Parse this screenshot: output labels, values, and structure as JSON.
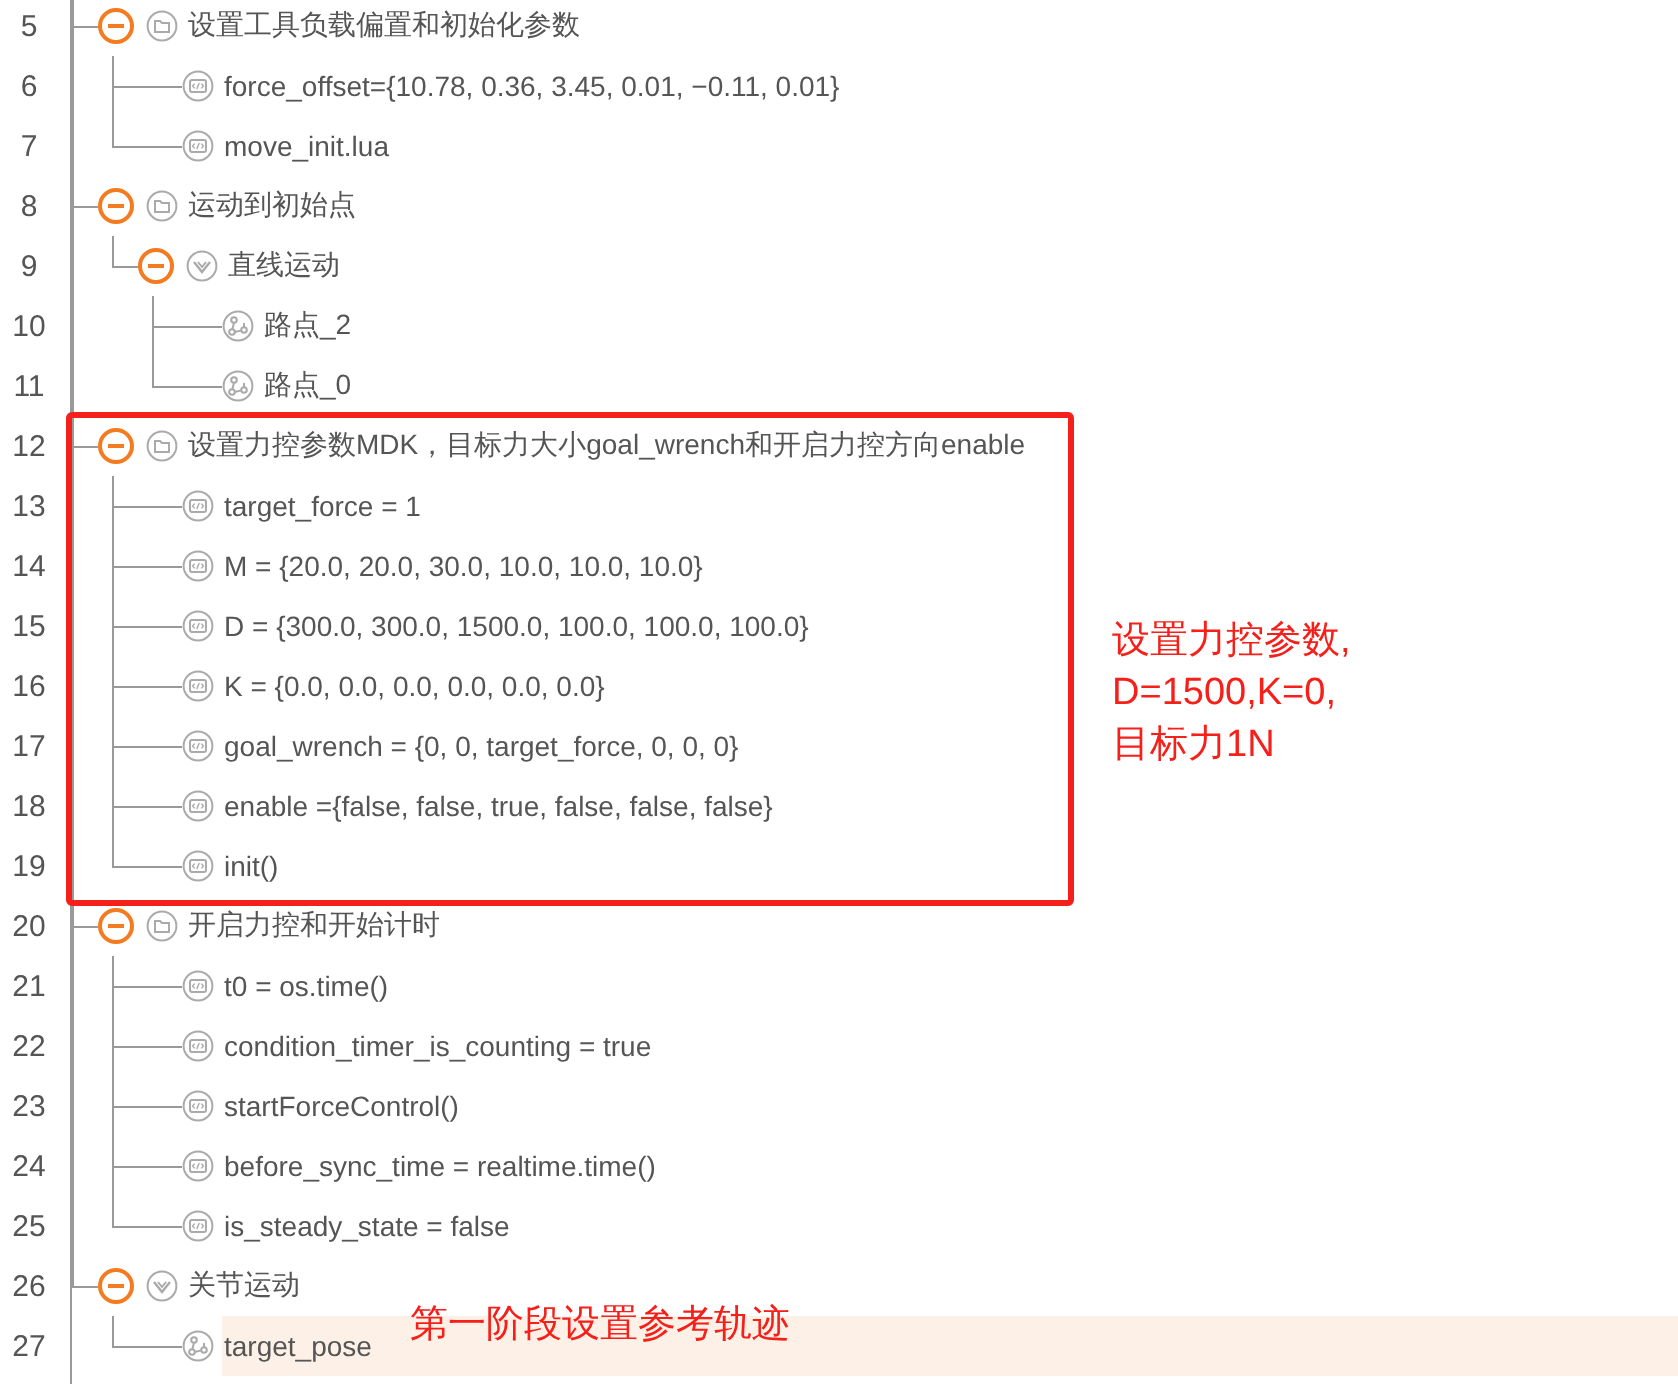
{
  "tree": [
    {
      "line": "5",
      "kind": "group",
      "label": "设置工具负载偏置和初始化参数",
      "expanded": true,
      "children": [
        {
          "line": "6",
          "kind": "code",
          "label": "force_offset={10.78, 0.36, 3.45, 0.01, −0.11, 0.01}"
        },
        {
          "line": "7",
          "kind": "code",
          "label": "move_init.lua"
        }
      ]
    },
    {
      "line": "8",
      "kind": "group",
      "label": "运动到初始点",
      "expanded": true,
      "children": [
        {
          "line": "9",
          "kind": "motion",
          "label": "直线运动",
          "expanded": true,
          "children": [
            {
              "line": "10",
              "kind": "waypoint",
              "label": "路点_2"
            },
            {
              "line": "11",
              "kind": "waypoint",
              "label": "路点_0"
            }
          ]
        }
      ]
    },
    {
      "line": "12",
      "kind": "group",
      "label": "设置力控参数MDK，目标力大小goal_wrench和开启力控方向enable",
      "expanded": true,
      "boxed": true,
      "children": [
        {
          "line": "13",
          "kind": "code",
          "label": "target_force = 1"
        },
        {
          "line": "14",
          "kind": "code",
          "label": "M = {20.0, 20.0, 30.0, 10.0, 10.0, 10.0}"
        },
        {
          "line": "15",
          "kind": "code",
          "label": "D = {300.0, 300.0, 1500.0, 100.0, 100.0, 100.0}"
        },
        {
          "line": "16",
          "kind": "code",
          "label": "K = {0.0, 0.0, 0.0, 0.0, 0.0, 0.0}"
        },
        {
          "line": "17",
          "kind": "code",
          "label": "goal_wrench = {0, 0, target_force, 0, 0, 0}"
        },
        {
          "line": "18",
          "kind": "code",
          "label": "enable ={false, false, true, false, false, false}"
        },
        {
          "line": "19",
          "kind": "code",
          "label": "init()"
        }
      ]
    },
    {
      "line": "20",
      "kind": "group",
      "label": "开启力控和开始计时",
      "expanded": true,
      "children": [
        {
          "line": "21",
          "kind": "code",
          "label": "t0 = os.time()"
        },
        {
          "line": "22",
          "kind": "code",
          "label": "condition_timer_is_counting = true"
        },
        {
          "line": "23",
          "kind": "code",
          "label": "startForceControl()"
        },
        {
          "line": "24",
          "kind": "code",
          "label": "before_sync_time = realtime.time()"
        },
        {
          "line": "25",
          "kind": "code",
          "label": "is_steady_state = false"
        }
      ]
    },
    {
      "line": "26",
      "kind": "motion",
      "label": "关节运动",
      "expanded": true,
      "children": [
        {
          "line": "27",
          "kind": "waypoint",
          "label": "target_pose",
          "selected": true
        }
      ]
    }
  ],
  "annotations": [
    {
      "kind": "side",
      "lines": [
        "设置力控参数,",
        "D=1500,K=0,",
        "目标力1N"
      ]
    },
    {
      "kind": "inline",
      "lines": [
        "第一阶段设置参考轨迹"
      ]
    }
  ]
}
